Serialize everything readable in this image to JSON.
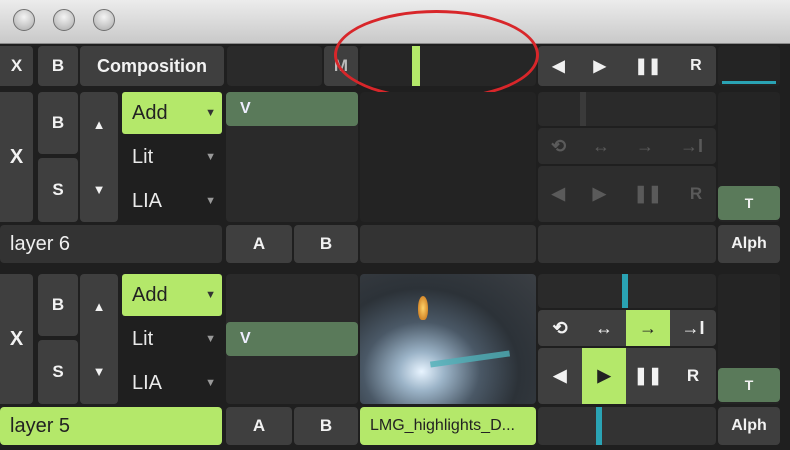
{
  "titlebar": {},
  "top_row": {
    "x_label": "X",
    "b_label": "B",
    "composition_label": "Composition",
    "m_label": "M",
    "transport": {
      "prev": "◀",
      "play": "▶",
      "pause": "❚❚",
      "r": "R"
    }
  },
  "layers": [
    {
      "name": "layer 6",
      "x_label": "X",
      "b_label": "B",
      "s_label": "S",
      "up": "▲",
      "down": "▼",
      "blend_modes": [
        "Add",
        "Lit",
        "LIA"
      ],
      "v_label": "V",
      "a_label": "A",
      "b2_label": "B",
      "clip_name": "",
      "t_label": "T",
      "alpha_label": "Alph",
      "loop_icons": {
        "loop": "⟲",
        "pingpong": "↔",
        "forward": "→",
        "stop": "→I"
      },
      "transport": {
        "prev": "◀",
        "play": "▶",
        "pause": "❚❚",
        "r": "R"
      }
    },
    {
      "name": "layer 5",
      "x_label": "X",
      "b_label": "B",
      "s_label": "S",
      "up": "▲",
      "down": "▼",
      "blend_modes": [
        "Add",
        "Lit",
        "LIA"
      ],
      "v_label": "V",
      "a_label": "A",
      "b2_label": "B",
      "clip_name": "LMG_highlights_D...",
      "t_label": "T",
      "alpha_label": "Alph",
      "loop_icons": {
        "loop": "⟲",
        "pingpong": "↔",
        "forward": "→",
        "stop": "→I"
      },
      "transport": {
        "prev": "◀",
        "play": "▶",
        "pause": "❚❚",
        "r": "R"
      }
    }
  ],
  "colors": {
    "accent": "#b4e86a",
    "highlight_ring": "#d8262a",
    "position_marker": "#2aa3b4"
  }
}
